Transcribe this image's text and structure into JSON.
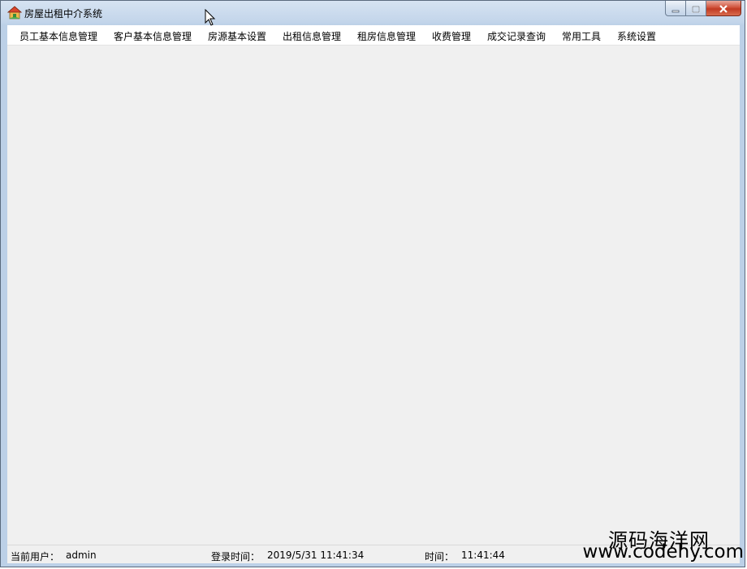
{
  "window": {
    "title": "房屋出租中介系统",
    "icon": "house-icon"
  },
  "window_controls": {
    "minimize_icon": "minimize-icon",
    "maximize_icon": "maximize-icon",
    "close_icon": "close-icon"
  },
  "menu": {
    "items": [
      {
        "label": "员工基本信息管理"
      },
      {
        "label": "客户基本信息管理"
      },
      {
        "label": "房源基本设置"
      },
      {
        "label": "出租信息管理"
      },
      {
        "label": "租房信息管理"
      },
      {
        "label": "收费管理"
      },
      {
        "label": "成交记录查询"
      },
      {
        "label": "常用工具"
      },
      {
        "label": "系统设置"
      }
    ]
  },
  "status": {
    "user_label": "当前用户：",
    "user_value": "admin",
    "login_label": "登录时间：",
    "login_value": "2019/5/31 11:41:34",
    "time_label": "时间：",
    "time_value": "11:41:44"
  },
  "watermark": {
    "name": "源码海洋网",
    "url": "www.codehy.com"
  },
  "colors": {
    "titlebar": "#c3d5ea",
    "client_bg": "#f0f0f0",
    "close_button": "#c13a22"
  }
}
